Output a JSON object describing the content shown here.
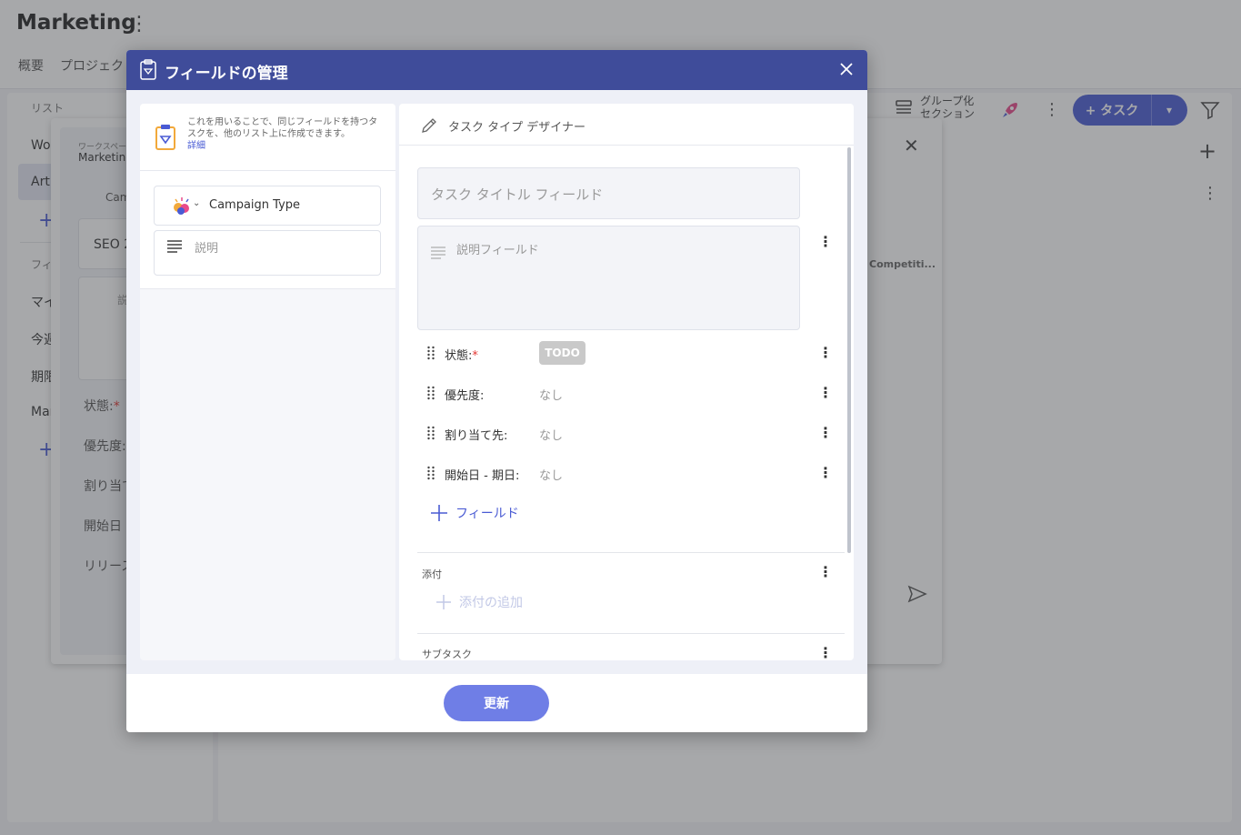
{
  "app": {
    "title": "Marketing",
    "menu_glyph": "⋮",
    "tabs": [
      "概要",
      "プロジェクト"
    ],
    "nav": {
      "lists_heading": "リスト",
      "item_work": "Wor",
      "item_active": "Arti",
      "filters_heading": "フィル",
      "item_my": "マイ",
      "item_week": "今週",
      "item_due": "期限",
      "item_mar": "Mar"
    },
    "toolbar": {
      "group_line1": "グループ化",
      "group_line2": "セクション",
      "task_button": "タスク"
    },
    "bg_panel": {
      "workspace_label": "ワークスペース",
      "workspace_value": "Marketing",
      "campaign_short": "Cam",
      "seo_value": "SEO 2",
      "desc_short": "説",
      "status": "状態:",
      "priority": "優先度:",
      "assignee": "割り当て",
      "date": "開始日 -",
      "release": "リリース:",
      "competition": "Competiti..."
    }
  },
  "modal": {
    "title": "フィールドの管理",
    "left": {
      "info_text": "これを用いることで、同じフィールドを持つタスクを、他のリスト上に作成できます。",
      "info_link": "詳細",
      "campaign_type_label": "Campaign Type",
      "description_label": "説明"
    },
    "right": {
      "designer_title": "タスク タイプ デザイナー",
      "title_field_placeholder": "タスク タイトル フィールド",
      "description_field_placeholder": "説明フィールド",
      "fields": [
        {
          "label": "状態:",
          "value": "TODO",
          "required": "*"
        },
        {
          "label": "優先度:",
          "value": "なし"
        },
        {
          "label": "割り当て先:",
          "value": "なし"
        },
        {
          "label": "開始日 - 期日:",
          "value": "なし"
        }
      ],
      "add_field_label": "フィールド",
      "attachments_heading": "添付",
      "add_attachment_label": "添付の追加",
      "subtasks_heading": "サブタスク"
    },
    "footer": {
      "update_button": "更新"
    }
  },
  "colors": {
    "header": "#3f4c9a",
    "accent": "#4a5bd4",
    "update_button": "#6f7ee6",
    "todo_badge": "#c9c9c9",
    "required": "#e53935"
  }
}
